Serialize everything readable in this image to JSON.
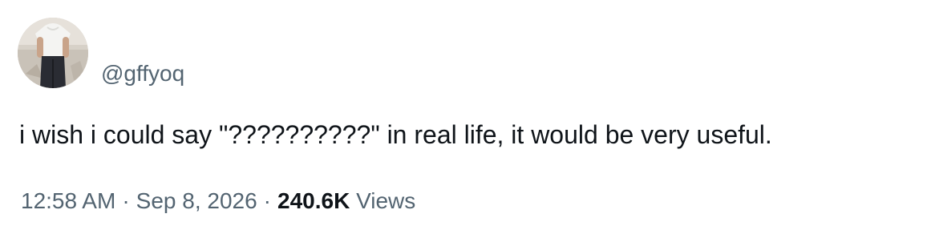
{
  "author": {
    "handle": "@gffyoq",
    "avatar_icon": "profile-photo"
  },
  "tweet": {
    "text": "i wish i could say \"??????????\" in real life, it would be very useful."
  },
  "meta": {
    "time": "12:58 AM",
    "separator": "·",
    "date": "Sep 8, 2026",
    "views_count": "240.6K",
    "views_label": "Views"
  },
  "colors": {
    "text_primary": "#0f1419",
    "text_secondary": "#536471",
    "background": "#ffffff"
  }
}
